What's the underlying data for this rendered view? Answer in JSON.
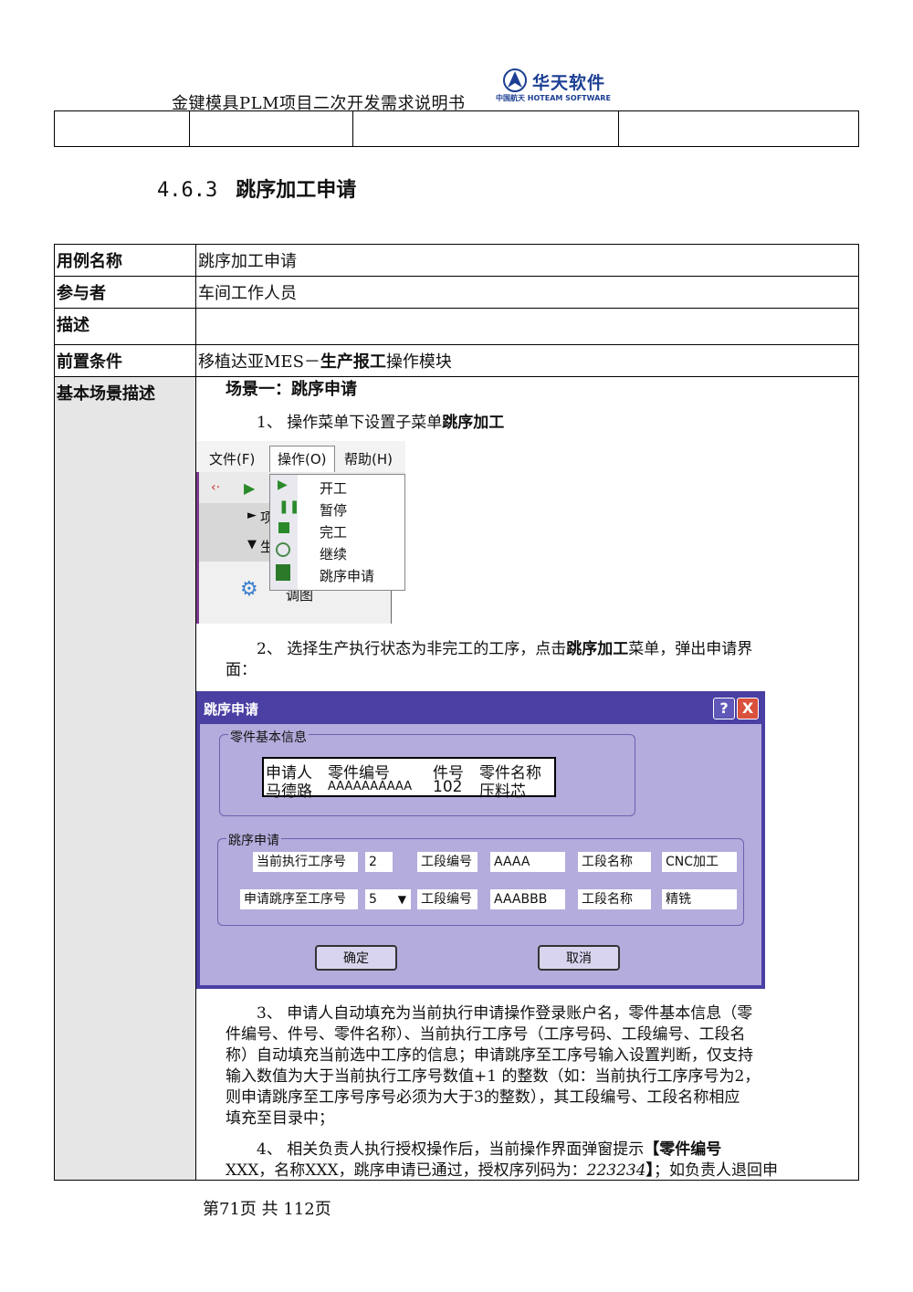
{
  "header": {
    "doc_title": "金键模具PLM项目二次开发需求说明书",
    "logo_name": "华天软件",
    "logo_sub": "中国航天 HOTEAM SOFTWARE"
  },
  "section": {
    "number": "4.6.3",
    "title": "跳序加工申请"
  },
  "table": {
    "rows": [
      {
        "label": "用例名称",
        "value": "跳序加工申请"
      },
      {
        "label": "参与者",
        "value": "车间工作人员"
      },
      {
        "label": "描述",
        "value": ""
      },
      {
        "label": "前置条件",
        "value_pre": "移植达亚MES－",
        "value_bold": "生产报工",
        "value_post": "操作模块"
      },
      {
        "label": "基本场景描述"
      }
    ]
  },
  "scene": {
    "title": "场景一：跳序申请",
    "step1_pre": "1、 操作菜单下设置子菜单",
    "step1_bold": "跳序加工",
    "step2_pre": "2、 选择生产执行状态为非完工的工序，点击",
    "step2_bold": "跳序加工",
    "step2_post": "菜单，弹出申请界",
    "step2_line2": "面：",
    "step3_lines": [
      "3、 申请人自动填充为当前执行申请操作登录账户名，零件基本信息（零",
      "件编号、件号、零件名称）、当前执行工序号（工序号码、工段编号、工段名",
      "称）自动填充当前选中工序的信息；申请跳序至工序号输入设置判断，仅支持",
      "输入数值为大于当前执行工序号数值+1 的整数（如：当前执行工序序号为2，",
      "则申请跳序至工序号序号必须为大于3的整数），其工段编号、工段名称相应",
      "填充至目录中；"
    ],
    "step4_line1_pre": "4、 相关负责人执行授权操作后，当前操作界面弹窗提示",
    "step4_line1_bold": "【零件编号",
    "step4_line2_a": "XXX，名称XXX，跳序申请已通过，授权序列码为：",
    "step4_code": "223234",
    "step4_bracket": "】",
    "step4_line2_b": "；如负责人退回申"
  },
  "menu_shot": {
    "menus": [
      "文件(F)",
      "操作(O)",
      "帮助(H)"
    ],
    "items": [
      "开工",
      "暂停",
      "完工",
      "继续",
      "跳序申请"
    ],
    "partial_a": "项",
    "partial_b": "生",
    "partial_c": "调图"
  },
  "dialog": {
    "title": "跳序申请",
    "help_btn": "?",
    "close_btn": "X",
    "group1": "零件基本信息",
    "grid_headers": [
      "申请人",
      "零件编号",
      "件号",
      "零件名称"
    ],
    "grid_values": [
      "马德路",
      "AAAAAAAAAA",
      "102",
      "压料芯"
    ],
    "group2": "跳序申请",
    "row1": {
      "label": "当前执行工序号",
      "value": "2",
      "seg_label": "工段编号",
      "seg_value": "AAAA",
      "name_label": "工段名称",
      "name_value": "CNC加工"
    },
    "row2": {
      "label": "申请跳序至工序号",
      "value": "5",
      "seg_label": "工段编号",
      "seg_value": "AAABBB",
      "name_label": "工段名称",
      "name_value": "精铣"
    },
    "ok": "确定",
    "cancel": "取消"
  },
  "footer": "第71页 共 112页"
}
